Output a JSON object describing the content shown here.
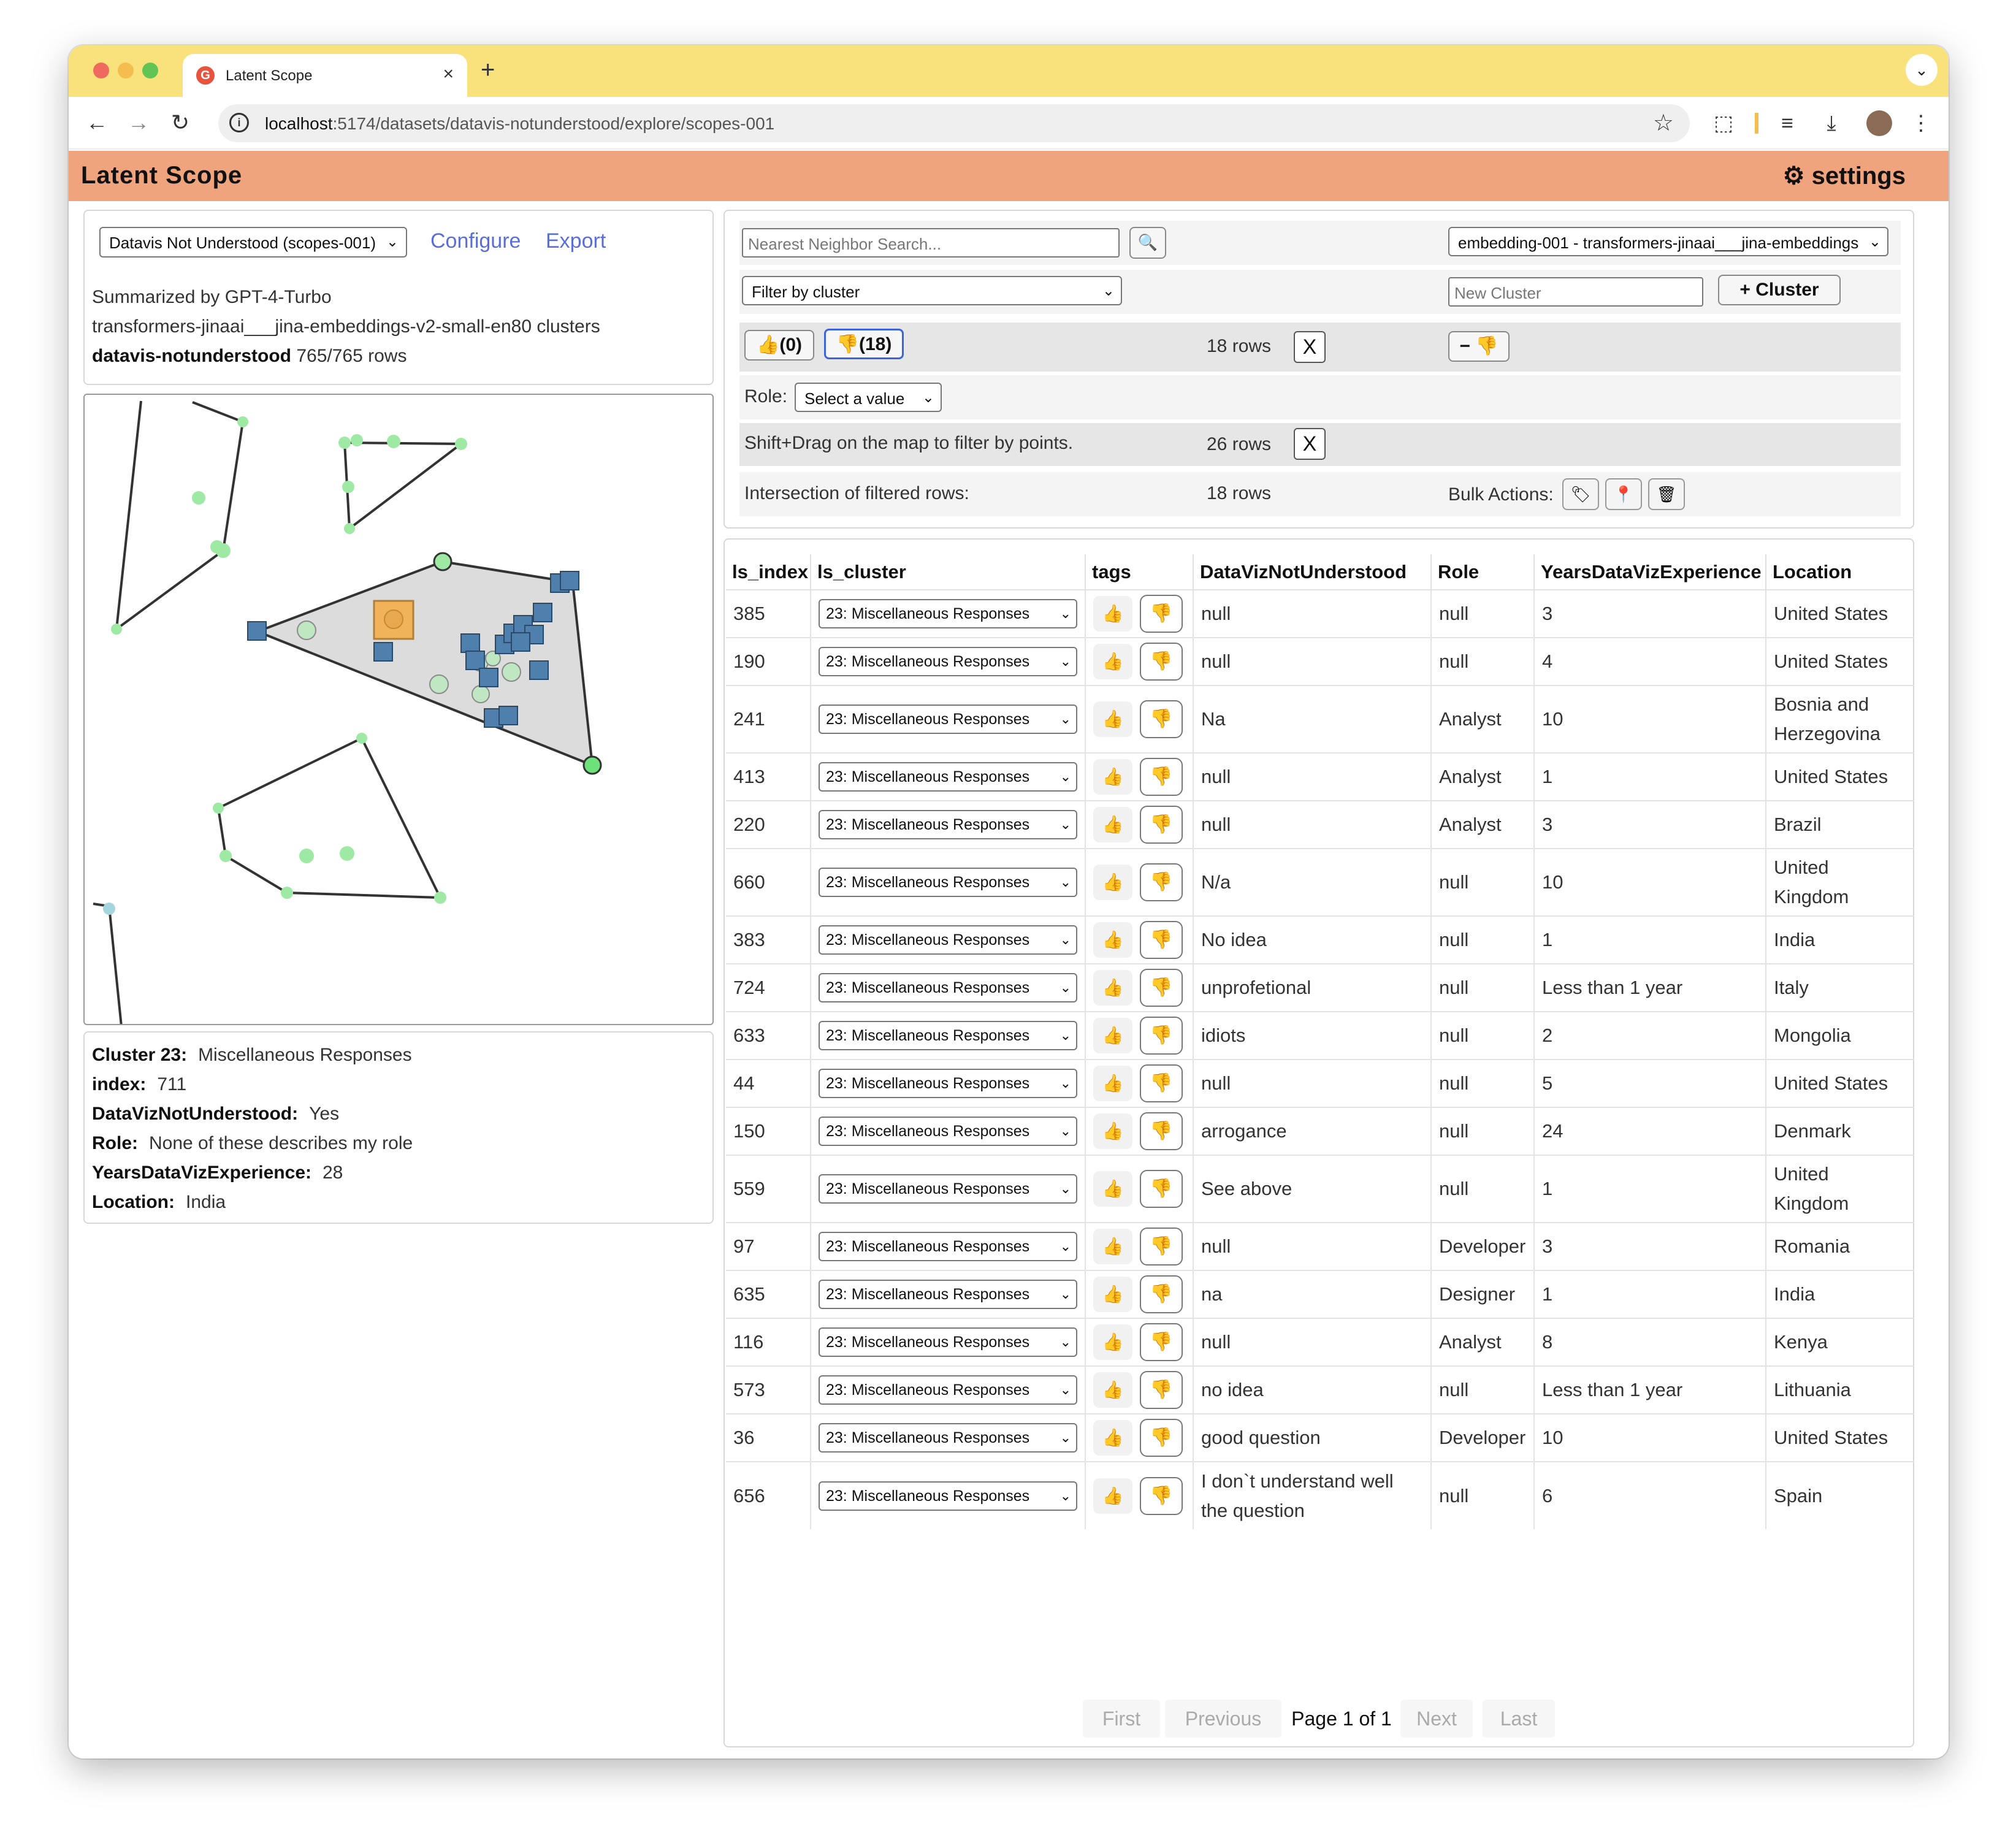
{
  "browser": {
    "tab_title": "Latent Scope",
    "tab_favicon": "G",
    "url_host": "localhost",
    "url_path": ":5174/datasets/datavis-notunderstood/explore/scopes-001",
    "icons": [
      "back-icon",
      "forward-icon",
      "reload-icon",
      "info-icon",
      "star-icon",
      "extension-icon",
      "media-icon",
      "download-icon",
      "avatar",
      "menu-icon"
    ]
  },
  "app": {
    "title": "Latent Scope",
    "settings_label": "⚙ settings",
    "header_color": "#f0a47e"
  },
  "scope": {
    "selected": "Datavis Not Understood (scopes-001)",
    "configure": "Configure",
    "export": "Export",
    "summary": "Summarized by GPT-4-Turbo",
    "model_line": "transformers-jinaai___jina-embeddings-v2-small-en80 clusters",
    "dataset_name": "datavis-notunderstood",
    "rows": "765/765 rows"
  },
  "hover": {
    "cluster_label": "Cluster 23:",
    "cluster_value": "Miscellaneous Responses",
    "index_label": "index:",
    "index_value": "711",
    "dvnu_label": "DataVizNotUnderstood:",
    "dvnu_value": "Yes",
    "role_label": "Role:",
    "role_value": "None of these describes my role",
    "yrs_label": "YearsDataVizExperience:",
    "yrs_value": "28",
    "loc_label": "Location:",
    "loc_value": "India"
  },
  "controls": {
    "nn_placeholder": "Nearest Neighbor Search...",
    "embedding_selected": "embedding-001 - transformers-jinaai___jina-embeddings",
    "cluster_filter": "Filter by cluster",
    "new_cluster_placeholder": "New Cluster",
    "add_cluster": "+ Cluster",
    "thumbs_up_count": "(0)",
    "thumbs_down_count": "(18)",
    "tag_rows": "18 rows",
    "remove_tag": "− 👎",
    "role_label": "Role:",
    "role_select": "Select a value",
    "map_hint": "Shift+Drag on the map to filter by points.",
    "map_rows": "26 rows",
    "intersection_label": "Intersection of filtered rows:",
    "intersection_rows": "18 rows",
    "bulk_label": "Bulk Actions:",
    "close": "X"
  },
  "table": {
    "headers": [
      "ls_index",
      "ls_cluster",
      "tags",
      "DataVizNotUnderstood",
      "Role",
      "YearsDataVizExperience",
      "Location"
    ],
    "rows": [
      {
        "idx": "385",
        "cluster": "23: Miscellaneous Responses",
        "dvnu": "null",
        "role": "null",
        "yrs": "3",
        "loc": "United States"
      },
      {
        "idx": "190",
        "cluster": "23: Miscellaneous Responses",
        "dvnu": "null",
        "role": "null",
        "yrs": "4",
        "loc": "United States"
      },
      {
        "idx": "241",
        "cluster": "23: Miscellaneous Responses",
        "dvnu": "Na",
        "role": "Analyst",
        "yrs": "10",
        "loc": "Bosnia and Herzegovina"
      },
      {
        "idx": "413",
        "cluster": "23: Miscellaneous Responses",
        "dvnu": "null",
        "role": "Analyst",
        "yrs": "1",
        "loc": "United States"
      },
      {
        "idx": "220",
        "cluster": "23: Miscellaneous Responses",
        "dvnu": "null",
        "role": "Analyst",
        "yrs": "3",
        "loc": "Brazil"
      },
      {
        "idx": "660",
        "cluster": "23: Miscellaneous Responses",
        "dvnu": "N/a",
        "role": "null",
        "yrs": "10",
        "loc": "United Kingdom"
      },
      {
        "idx": "383",
        "cluster": "23: Miscellaneous Responses",
        "dvnu": "No idea",
        "role": "null",
        "yrs": "1",
        "loc": "India"
      },
      {
        "idx": "724",
        "cluster": "23: Miscellaneous Responses",
        "dvnu": "unprofetional",
        "role": "null",
        "yrs": "Less than 1 year",
        "loc": "Italy"
      },
      {
        "idx": "633",
        "cluster": "23: Miscellaneous Responses",
        "dvnu": "idiots",
        "role": "null",
        "yrs": "2",
        "loc": "Mongolia"
      },
      {
        "idx": "44",
        "cluster": "23: Miscellaneous Responses",
        "dvnu": "null",
        "role": "null",
        "yrs": "5",
        "loc": "United States"
      },
      {
        "idx": "150",
        "cluster": "23: Miscellaneous Responses",
        "dvnu": "arrogance",
        "role": "null",
        "yrs": "24",
        "loc": "Denmark"
      },
      {
        "idx": "559",
        "cluster": "23: Miscellaneous Responses",
        "dvnu": "See above",
        "role": "null",
        "yrs": "1",
        "loc": "United Kingdom"
      },
      {
        "idx": "97",
        "cluster": "23: Miscellaneous Responses",
        "dvnu": "null",
        "role": "Developer",
        "yrs": "3",
        "loc": "Romania"
      },
      {
        "idx": "635",
        "cluster": "23: Miscellaneous Responses",
        "dvnu": "na",
        "role": "Designer",
        "yrs": "1",
        "loc": "India"
      },
      {
        "idx": "116",
        "cluster": "23: Miscellaneous Responses",
        "dvnu": "null",
        "role": "Analyst",
        "yrs": "8",
        "loc": "Kenya"
      },
      {
        "idx": "573",
        "cluster": "23: Miscellaneous Responses",
        "dvnu": "no idea",
        "role": "null",
        "yrs": "Less than 1 year",
        "loc": "Lithuania"
      },
      {
        "idx": "36",
        "cluster": "23: Miscellaneous Responses",
        "dvnu": "good question",
        "role": "Developer",
        "yrs": "10",
        "loc": "United States"
      },
      {
        "idx": "656",
        "cluster": "23: Miscellaneous Responses",
        "dvnu": "I don`t understand well the question",
        "role": "null",
        "yrs": "6",
        "loc": "Spain"
      }
    ]
  },
  "pagination": {
    "first": "First",
    "previous": "Previous",
    "page_info": "Page 1 of 1",
    "next": "Next",
    "last": "Last"
  }
}
